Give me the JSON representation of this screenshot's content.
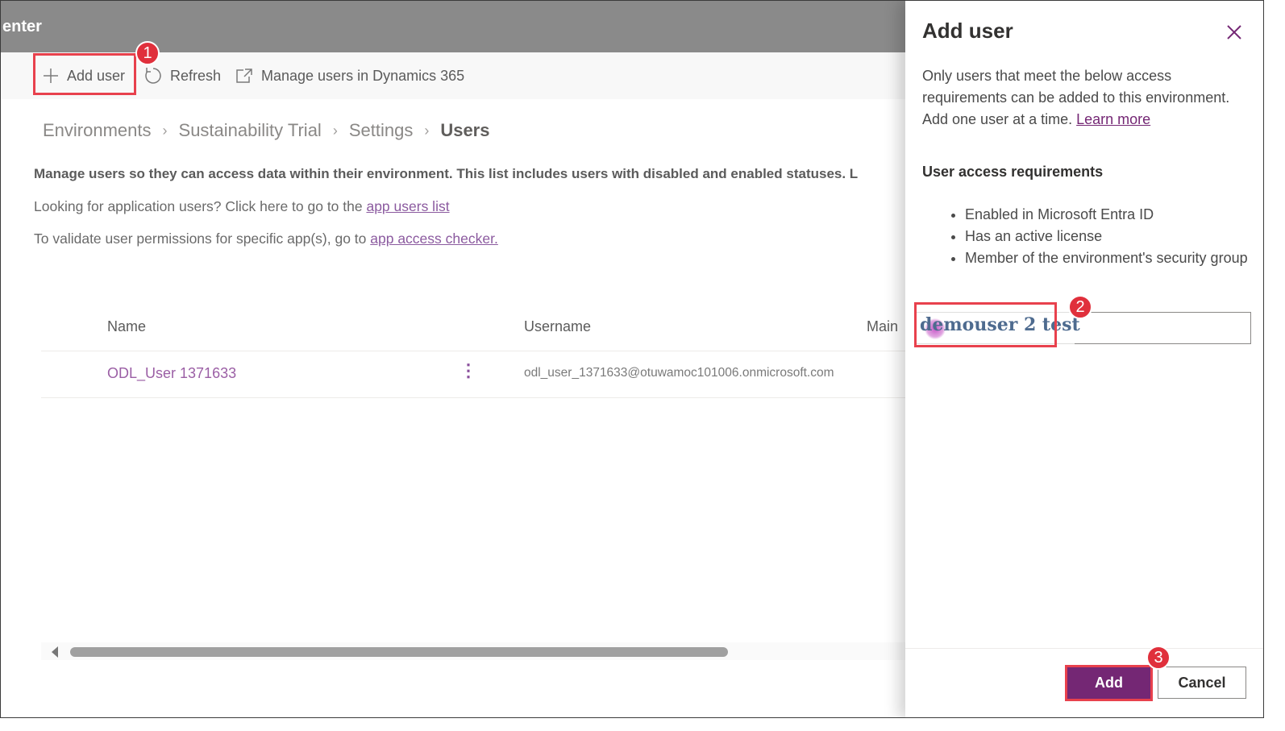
{
  "topbar": {
    "title_fragment": "enter"
  },
  "commands": {
    "add_user": "Add user",
    "refresh": "Refresh",
    "manage_d365": "Manage users in Dynamics 365"
  },
  "breadcrumb": [
    "Environments",
    "Sustainability Trial",
    "Settings",
    "Users"
  ],
  "description": {
    "bold": "Manage users so they can access data within their environment. This list includes users with disabled and enabled statuses. L",
    "app_users_prefix": "Looking for application users? Click here to go to the ",
    "app_users_link": "app users list",
    "checker_prefix": "To validate user permissions for specific app(s), go to ",
    "checker_link": "app access checker."
  },
  "table": {
    "columns": [
      "Name",
      "Username",
      "Main"
    ],
    "rows": [
      {
        "name": "ODL_User 1371633",
        "username": "odl_user_1371633@otuwamoc101006.onmicrosoft.com"
      }
    ]
  },
  "panel": {
    "title": "Add user",
    "description": "Only users that meet the below access requirements can be added to this environment. Add one user at a time.",
    "learn_more": "Learn more",
    "requirements_heading": "User access requirements",
    "requirements": [
      "Enabled in Microsoft Entra ID",
      "Has an active license",
      "Member of the environment's security group"
    ],
    "input_value": "demouser 2 test",
    "add_button": "Add",
    "cancel_button": "Cancel"
  },
  "annotations": {
    "step1": "1",
    "step2": "2",
    "step3": "3"
  },
  "colors": {
    "accent": "#742774",
    "link": "#8b5a9f",
    "highlight": "#e8414d",
    "topbar": "#8a8a8a"
  },
  "icons": [
    "add-icon",
    "refresh-icon",
    "external-link-icon",
    "close-icon",
    "more-icon"
  ]
}
